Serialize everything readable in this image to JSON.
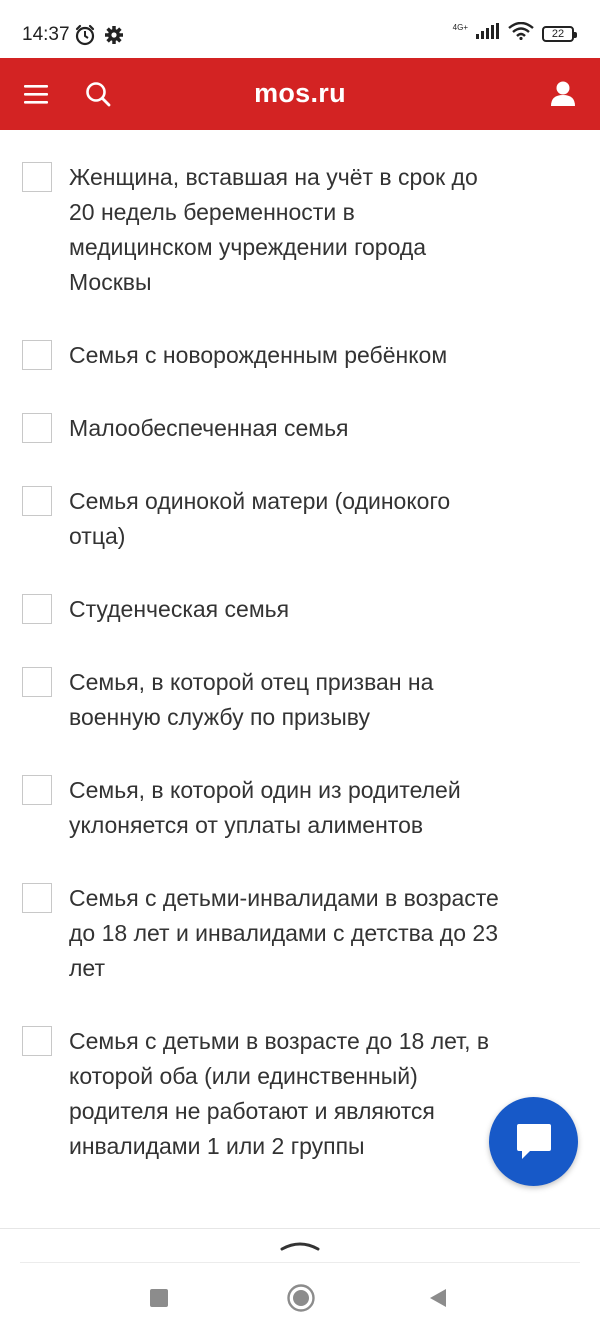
{
  "status_bar": {
    "time": "14:37",
    "network": "4G+",
    "battery": "22"
  },
  "header": {
    "brand": "mos.ru"
  },
  "items": [
    {
      "label": "Женщина, вставшая на учёт в срок до 20 недель беременности в медицинском учреждении города Москвы",
      "checked": false
    },
    {
      "label": "Семья с новорожденным ребёнком",
      "checked": false
    },
    {
      "label": "Малообеспеченная семья",
      "checked": false
    },
    {
      "label": "Семья одинокой матери (одинокого отца)",
      "checked": false
    },
    {
      "label": "Студенческая семья",
      "checked": false
    },
    {
      "label": "Семья, в которой отец призван на военную службу по призыву",
      "checked": false
    },
    {
      "label": "Семья, в которой один из родителей уклоняется от уплаты алиментов",
      "checked": false
    },
    {
      "label": "Семья с детьми-инвалидами в возрасте до 18 лет и инвалидами с детства до 23 лет",
      "checked": false
    },
    {
      "label": "Семья с детьми в возрасте до 18 лет, в которой оба (или единственный) родителя не работают и являются инвалидами 1 или 2 группы",
      "checked": false
    }
  ],
  "colors": {
    "header_red": "#d32323",
    "chat_blue": "#1759c8",
    "text": "#333333"
  },
  "icons": {
    "menu": "menu-icon",
    "search": "search-icon",
    "user": "user-icon",
    "chat": "chat-icon",
    "chevron": "chevron-up-icon"
  }
}
